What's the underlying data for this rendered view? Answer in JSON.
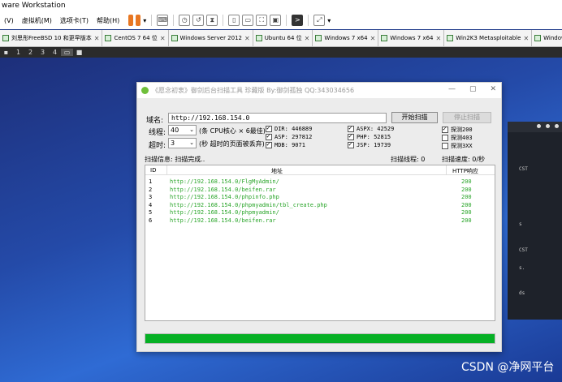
{
  "vmware": {
    "title": "ware Workstation",
    "menu": [
      "(V)",
      "虚拟机(M)",
      "选项卡(T)",
      "帮助(H)"
    ],
    "tabs": [
      "刘思彤FreeBSD 10 和更早版本",
      "CentOS 7 64 位",
      "Windows Server 2012",
      "Ubuntu 64 位",
      "Windows 7 x64",
      "Windows 7 x64",
      "Win2K3 Metasploitable",
      "Windows S"
    ],
    "guest_bar": [
      "1",
      "2",
      "3",
      "4"
    ]
  },
  "app": {
    "title": "《愿念初衷》御剑后台扫描工具 珍藏版 By:御剑孤独 QQ:343034656",
    "domain_label": "域名:",
    "domain_value": "http://192.168.154.0",
    "start_button": "开始扫描",
    "stop_button": "停止扫描",
    "threads_label": "线程:",
    "threads_value": "40",
    "threads_hint": "(条 CPU核心 × 6最佳)",
    "timeout_label": "超时:",
    "timeout_value": "3",
    "timeout_hint": "(秒 超时的页面被丢弃)",
    "dicts": [
      {
        "label": "DIR: 446889",
        "checked": true
      },
      {
        "label": "ASP: 297812",
        "checked": true
      },
      {
        "label": "MDB: 9071",
        "checked": true
      },
      {
        "label": "ASPX: 42529",
        "checked": true
      },
      {
        "label": "PHP: 52815",
        "checked": true
      },
      {
        "label": "JSP: 19739",
        "checked": true
      }
    ],
    "probes": [
      {
        "label": "探测200",
        "checked": true
      },
      {
        "label": "探测403",
        "checked": false
      },
      {
        "label": "探测3XX",
        "checked": false
      }
    ],
    "scan_info": "扫描信息: 扫描完成..",
    "scan_threads": "扫描线程: 0",
    "scan_speed": "扫描速度: 0/秒",
    "columns": {
      "id": "ID",
      "url": "地址",
      "code": "HTTP响应"
    },
    "rows": [
      {
        "id": "1",
        "url": "http://192.168.154.0/FlgMyAdmin/",
        "code": "200"
      },
      {
        "id": "2",
        "url": "http://192.168.154.0/beifen.rar",
        "code": "200"
      },
      {
        "id": "3",
        "url": "http://192.168.154.0/phpinfo.php",
        "code": "200"
      },
      {
        "id": "4",
        "url": "http://192.168.154.0/phpmyadmin/tbl_create.php",
        "code": "200"
      },
      {
        "id": "5",
        "url": "http://192.168.154.0/phpmyadmin/",
        "code": "200"
      },
      {
        "id": "6",
        "url": "http://192.168.154.0/beifen.rar",
        "code": "200"
      }
    ],
    "progress": 1.0
  },
  "terminal": {
    "lines": [
      "CST",
      "s",
      "CST",
      "s.",
      "ds"
    ]
  },
  "watermark": "CSDN @净网平台"
}
